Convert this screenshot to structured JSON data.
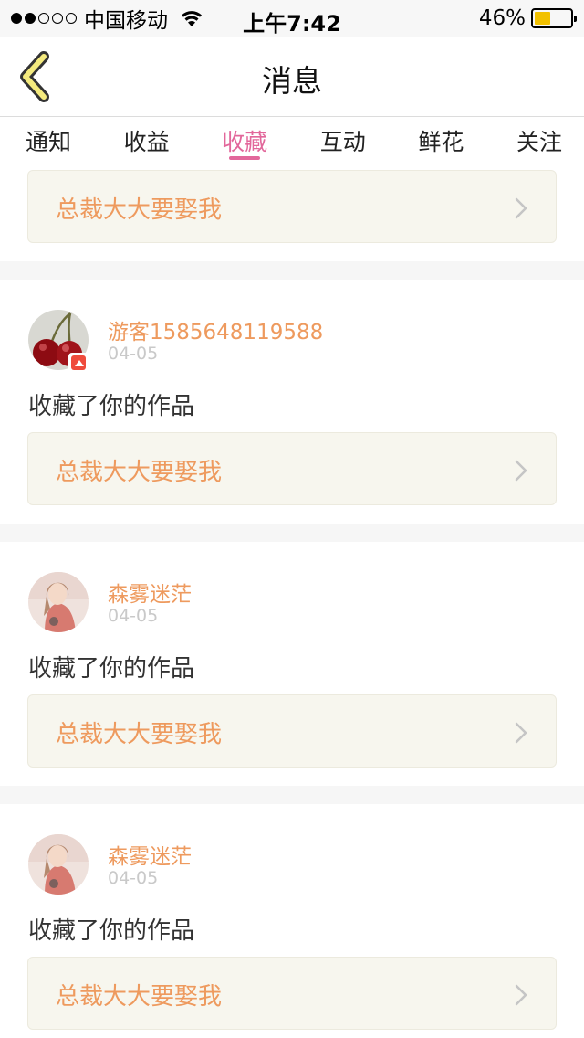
{
  "status_bar": {
    "carrier": "中国移动",
    "time": "上午7:42",
    "battery_percent": "46%",
    "battery_level": 0.46,
    "signal_bars": 2
  },
  "nav": {
    "title": "消息",
    "back_icon": "chevron-left-icon"
  },
  "tabs": [
    {
      "label": "通知",
      "active": false
    },
    {
      "label": "收益",
      "active": false
    },
    {
      "label": "收藏",
      "active": true
    },
    {
      "label": "互动",
      "active": false
    },
    {
      "label": "鲜花",
      "active": false
    },
    {
      "label": "关注",
      "active": false
    }
  ],
  "colors": {
    "accent": "#e2679b",
    "name": "#ee9a5e",
    "work_title": "#ee9a5e",
    "work_box_bg": "#f7f6ee"
  },
  "first_item": {
    "work_title": "总裁大大要娶我"
  },
  "items": [
    {
      "user_name": "游客1585648119588",
      "date": "04-05",
      "action": "收藏了你的作品",
      "work_title": "总裁大大要娶我",
      "avatar_icon": "cherry-avatar"
    },
    {
      "user_name": "森雾迷茫",
      "date": "04-05",
      "action": "收藏了你的作品",
      "work_title": "总裁大大要娶我",
      "avatar_icon": "girl-avatar"
    },
    {
      "user_name": "森雾迷茫",
      "date": "04-05",
      "action": "收藏了你的作品",
      "work_title": "总裁大大要娶我",
      "avatar_icon": "girl-avatar"
    }
  ]
}
